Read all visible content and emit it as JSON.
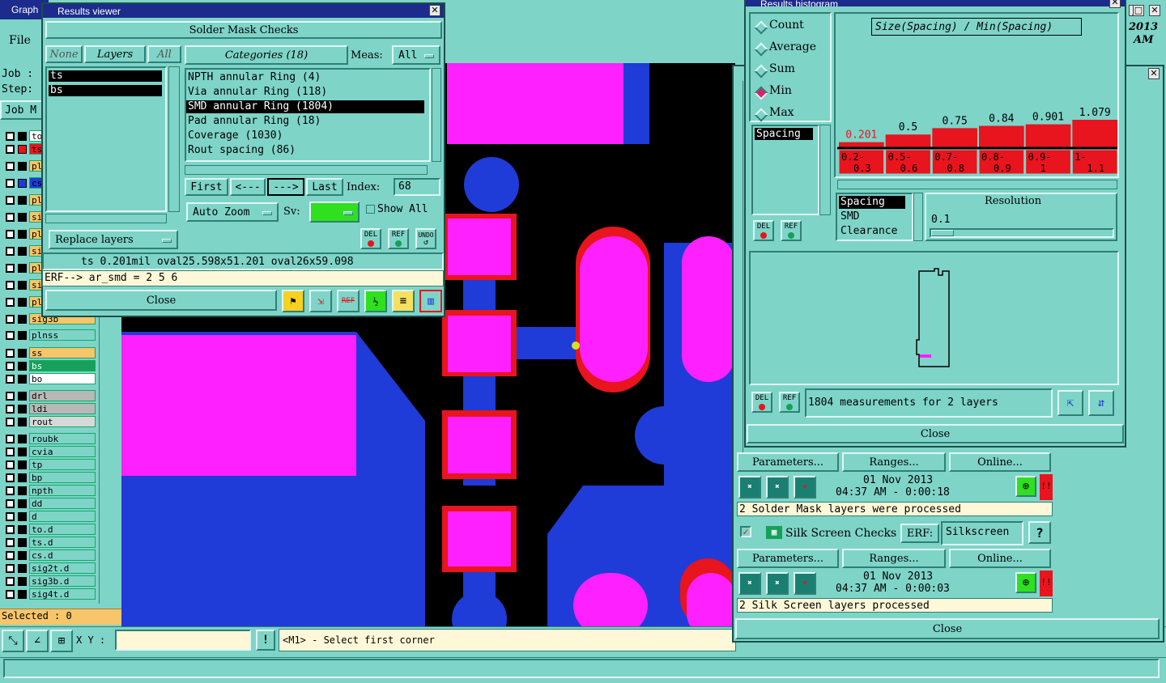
{
  "main_window": {
    "title": "Graph",
    "menu_file": "File",
    "job_label": "Job :",
    "step_label": "Step:",
    "job_button": "Job M",
    "selected_label": "Selected : 0",
    "xy_label": "X Y :",
    "xy_value": "",
    "status_message": "<M1> - Select first corner",
    "clock": [
      "2013",
      "AM"
    ],
    "layers": [
      {
        "name": "to",
        "color": "#ffffff",
        "swatch": "#000000"
      },
      {
        "name": "ts",
        "color": "#e8141e",
        "swatch": "#e8141e"
      },
      {
        "name": "pl",
        "color": "#f7c56a",
        "swatch": "#000000"
      },
      {
        "name": "cs",
        "color": "#1f3bd8",
        "swatch": "#1f3bd8"
      },
      {
        "name": "pl",
        "color": "#f7c56a",
        "swatch": "#000000"
      },
      {
        "name": "si",
        "color": "#f7c56a",
        "swatch": "#000000"
      },
      {
        "name": "pl",
        "color": "#f7c56a",
        "swatch": "#000000"
      },
      {
        "name": "si",
        "color": "#f7c56a",
        "swatch": "#000000"
      },
      {
        "name": "pl",
        "color": "#f7c56a",
        "swatch": "#000000"
      },
      {
        "name": "si",
        "color": "#f7c56a",
        "swatch": "#000000"
      },
      {
        "name": "pl",
        "color": "#f7c56a",
        "swatch": "#000000"
      },
      {
        "name": "sig3b",
        "color": "#f7c56a",
        "swatch": "#000000"
      },
      {
        "name": "plnss",
        "color": "#7fd4c8",
        "swatch": "#000000"
      },
      {
        "name": "ss",
        "color": "#f7c56a",
        "swatch": "#000000"
      },
      {
        "name": "bs",
        "color": "#16a05a",
        "swatch": "#000000"
      },
      {
        "name": "bo",
        "color": "#ffffff",
        "swatch": "#000000"
      },
      {
        "name": "drl",
        "color": "#b8b8b8",
        "swatch": "#000000"
      },
      {
        "name": "ldi",
        "color": "#b8b8b8",
        "swatch": "#000000"
      },
      {
        "name": "rout",
        "color": "#d8d8d8",
        "swatch": "#000000"
      },
      {
        "name": "roubk",
        "color": "#7fd4c8",
        "swatch": "#000000"
      },
      {
        "name": "cvia",
        "color": "#7fd4c8",
        "swatch": "#000000"
      },
      {
        "name": "tp",
        "color": "#7fd4c8",
        "swatch": "#000000"
      },
      {
        "name": "bp",
        "color": "#7fd4c8",
        "swatch": "#000000"
      },
      {
        "name": "npth",
        "color": "#7fd4c8",
        "swatch": "#000000"
      },
      {
        "name": "dd",
        "color": "#7fd4c8",
        "swatch": "#000000"
      },
      {
        "name": "d",
        "color": "#7fd4c8",
        "swatch": "#000000"
      },
      {
        "name": "to.d",
        "color": "#7fd4c8",
        "swatch": "#000000"
      },
      {
        "name": "ts.d",
        "color": "#7fd4c8",
        "swatch": "#000000"
      },
      {
        "name": "cs.d",
        "color": "#7fd4c8",
        "swatch": "#000000"
      },
      {
        "name": "sig2t.d",
        "color": "#7fd4c8",
        "swatch": "#000000"
      },
      {
        "name": "sig3b.d",
        "color": "#7fd4c8",
        "swatch": "#000000"
      },
      {
        "name": "sig4t.d",
        "color": "#7fd4c8",
        "swatch": "#000000"
      }
    ]
  },
  "results_viewer": {
    "title": "Results viewer",
    "header": "Solder Mask Checks",
    "btn_none": "None",
    "btn_layers": "Layers",
    "btn_all": "All",
    "layers": [
      "ts",
      "bs"
    ],
    "categories_label": "Categories (18)",
    "meas_label": "Meas:",
    "meas_value": "All",
    "categories": [
      "NPTH annular Ring (4)",
      "Via annular Ring (118)",
      "SMD annular Ring (1804)",
      "Pad annular Ring (18)",
      "Coverage (1030)",
      "Rout spacing (86)"
    ],
    "selected_category": 2,
    "btn_first": "First",
    "btn_prev": "<---",
    "btn_next": "--->",
    "btn_last": "Last",
    "index_label": "Index:",
    "index_value": "68",
    "auto_zoom": "Auto Zoom",
    "sv_label": "Sv:",
    "show_all": "Show All",
    "replace_layers": "Replace layers",
    "icon_del": "DEL",
    "icon_ref": "REF",
    "icon_undo": "UNDO",
    "measurement": "ts 0.201mil  oval25.598x51.201  oval26x59.098",
    "erf_line": "ERF--> ar_smd = 2 5 6",
    "close": "Close"
  },
  "histogram": {
    "title": "Results histogram",
    "modes": [
      "Count",
      "Average",
      "Sum",
      "Min",
      "Max"
    ],
    "selected_mode": 3,
    "chart_title": "Size(Spacing) / Min(Spacing)",
    "list_left": [
      "Spacing"
    ],
    "icon_del": "DEL",
    "icon_ref": "REF",
    "list_right": [
      "Spacing",
      "SMD",
      "Clearance"
    ],
    "resolution_label": "Resolution",
    "resolution_value": "0.1",
    "summary": "1804 measurements for 2 layers",
    "close": "Close"
  },
  "chart_data": {
    "type": "bar",
    "title": "Size(Spacing) / Min(Spacing)",
    "categories": [
      "0.2-0.3",
      "0.5-0.6",
      "0.7-0.8",
      "0.8-0.9",
      "0.9-1",
      "1-1.1"
    ],
    "category_labels": [
      [
        "0.2-",
        "0.3"
      ],
      [
        "0.5-",
        "0.6"
      ],
      [
        "0.7-",
        "0.8"
      ],
      [
        "0.8-",
        "0.9"
      ],
      [
        "0.9-",
        "1"
      ],
      [
        "1-",
        "1.1"
      ]
    ],
    "values": [
      0.201,
      0.5,
      0.75,
      0.84,
      0.901,
      1.079
    ],
    "value_labels": [
      "0.201",
      "0.5",
      "0.75",
      "0.84",
      "0.901",
      "1.079"
    ],
    "ylim": [
      0,
      1.079
    ],
    "bar_color": "#e8141e",
    "first_label_color": "#e8141e"
  },
  "checks_panel": {
    "btn_parameters": "Parameters...",
    "btn_ranges": "Ranges...",
    "btn_online": "Online...",
    "sm_date": "01 Nov 2013",
    "sm_time": "04:37 AM - 0:00:18",
    "sm_status": "2 Solder Mask layers were processed",
    "silk_title": "Silk Screen Checks",
    "erf_label": "ERF:",
    "erf_value": "Silkscreen",
    "help": "?",
    "ss_date": "01 Nov 2013",
    "ss_time": "04:37 AM - 0:00:03",
    "ss_status": "2 Silk Screen layers processed",
    "close": "Close",
    "alert": "!!"
  }
}
